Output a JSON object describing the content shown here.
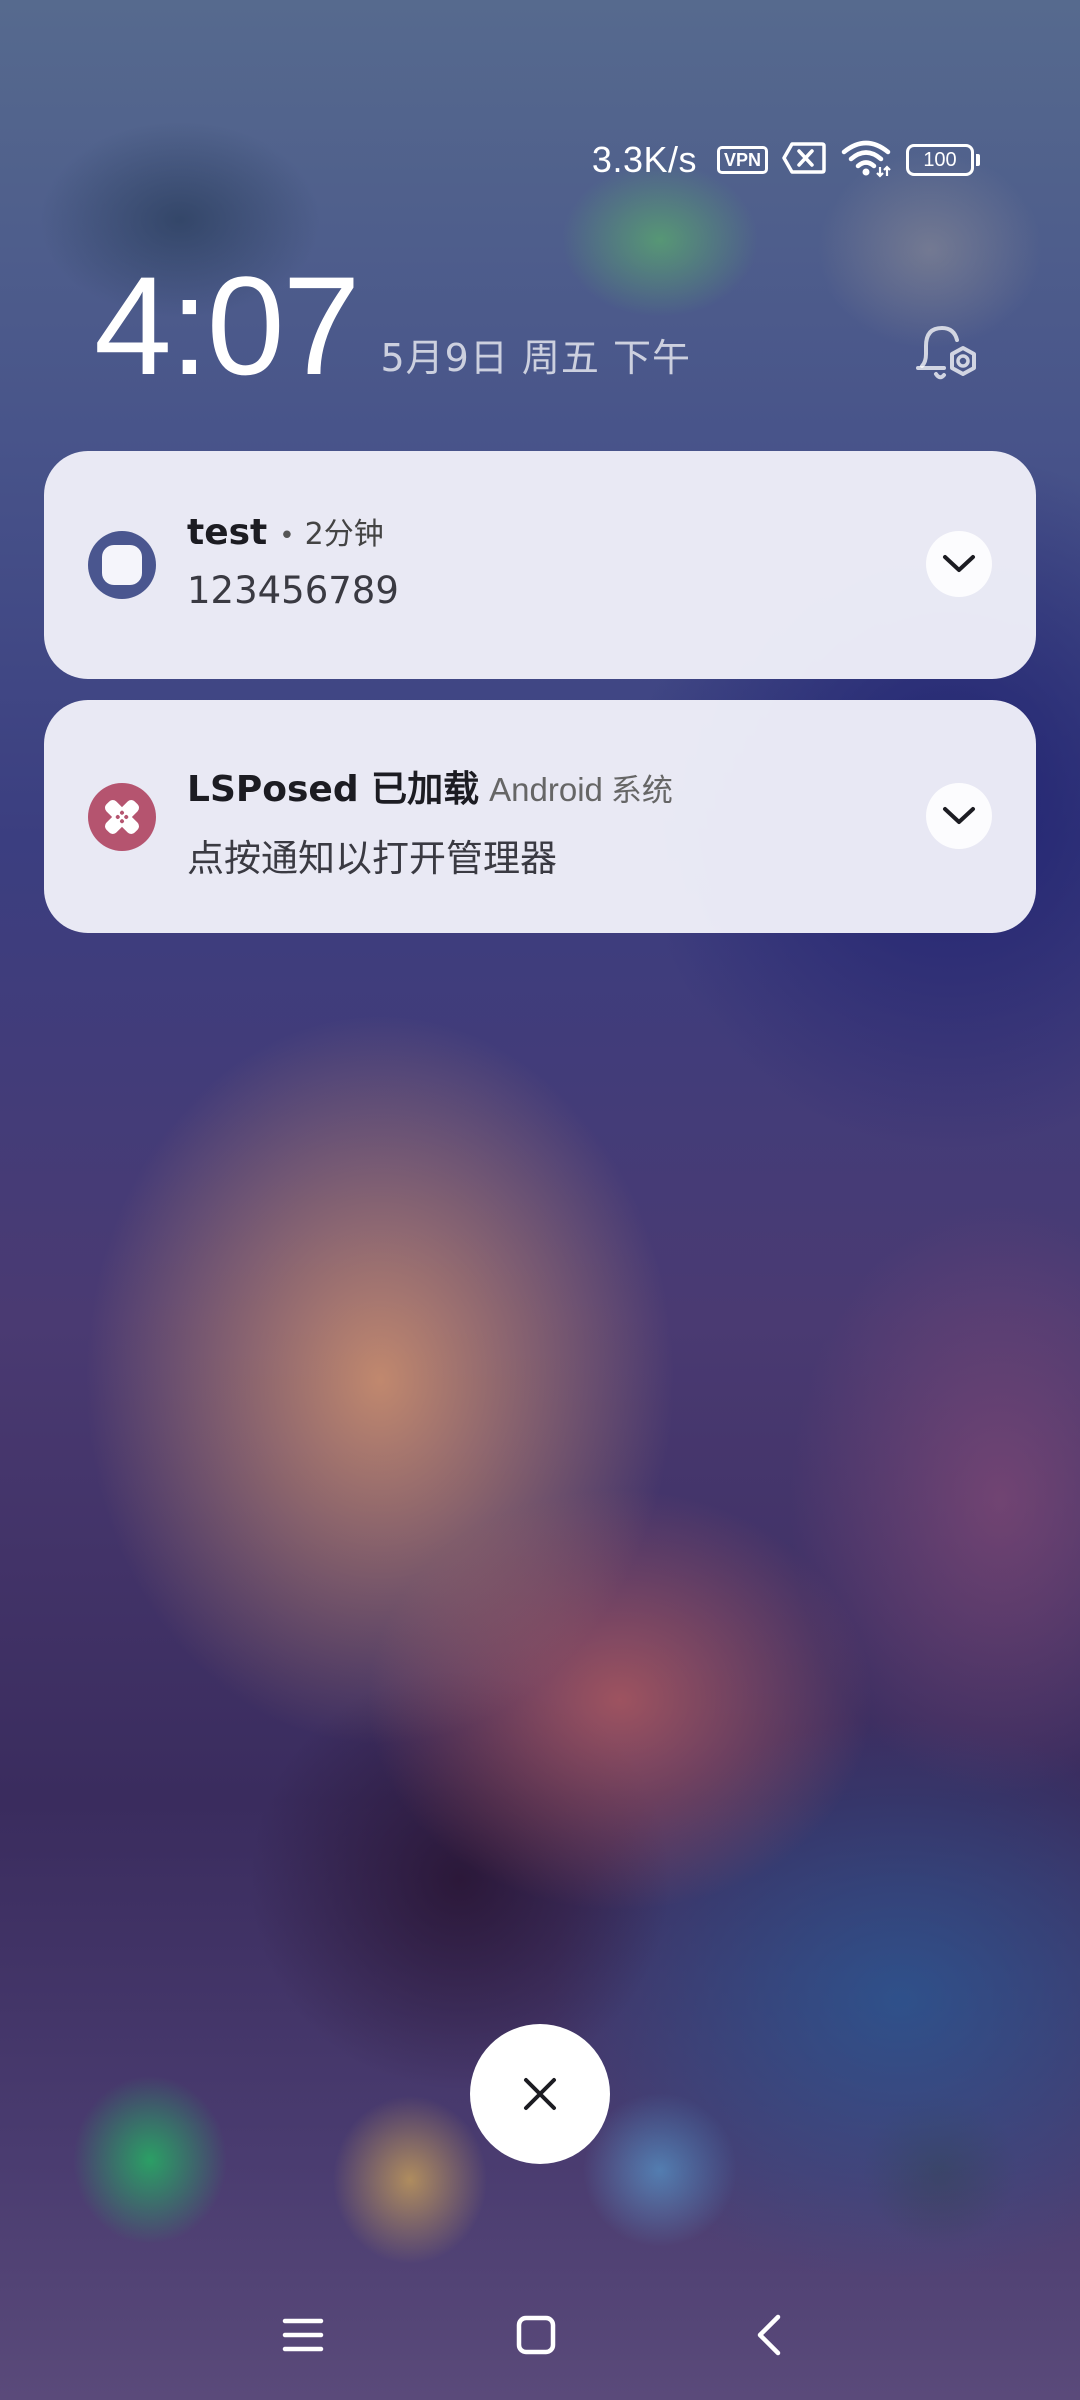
{
  "status_bar": {
    "net_speed": "3.3K/s",
    "vpn_label": "VPN",
    "battery_level": "100",
    "icons": [
      "vpn-icon",
      "no-sim-icon",
      "wifi-icon",
      "battery-icon"
    ]
  },
  "lockscreen": {
    "time": "4:07",
    "date": "5月9日 周五 下午"
  },
  "notifications": [
    {
      "title": "test",
      "time_ago": "2分钟",
      "body": "123456789",
      "icon": "app-square-icon",
      "icon_color": "#4a568f"
    },
    {
      "title": "LSPosed 已加载",
      "app_name": "Android",
      "app_name_cn": "系统",
      "body": "点按通知以打开管理器",
      "icon": "lsposed-icon",
      "icon_color": "#b5546f"
    }
  ],
  "colors": {
    "card_background": "#eeeef8",
    "clear_button": "#ffffff"
  }
}
